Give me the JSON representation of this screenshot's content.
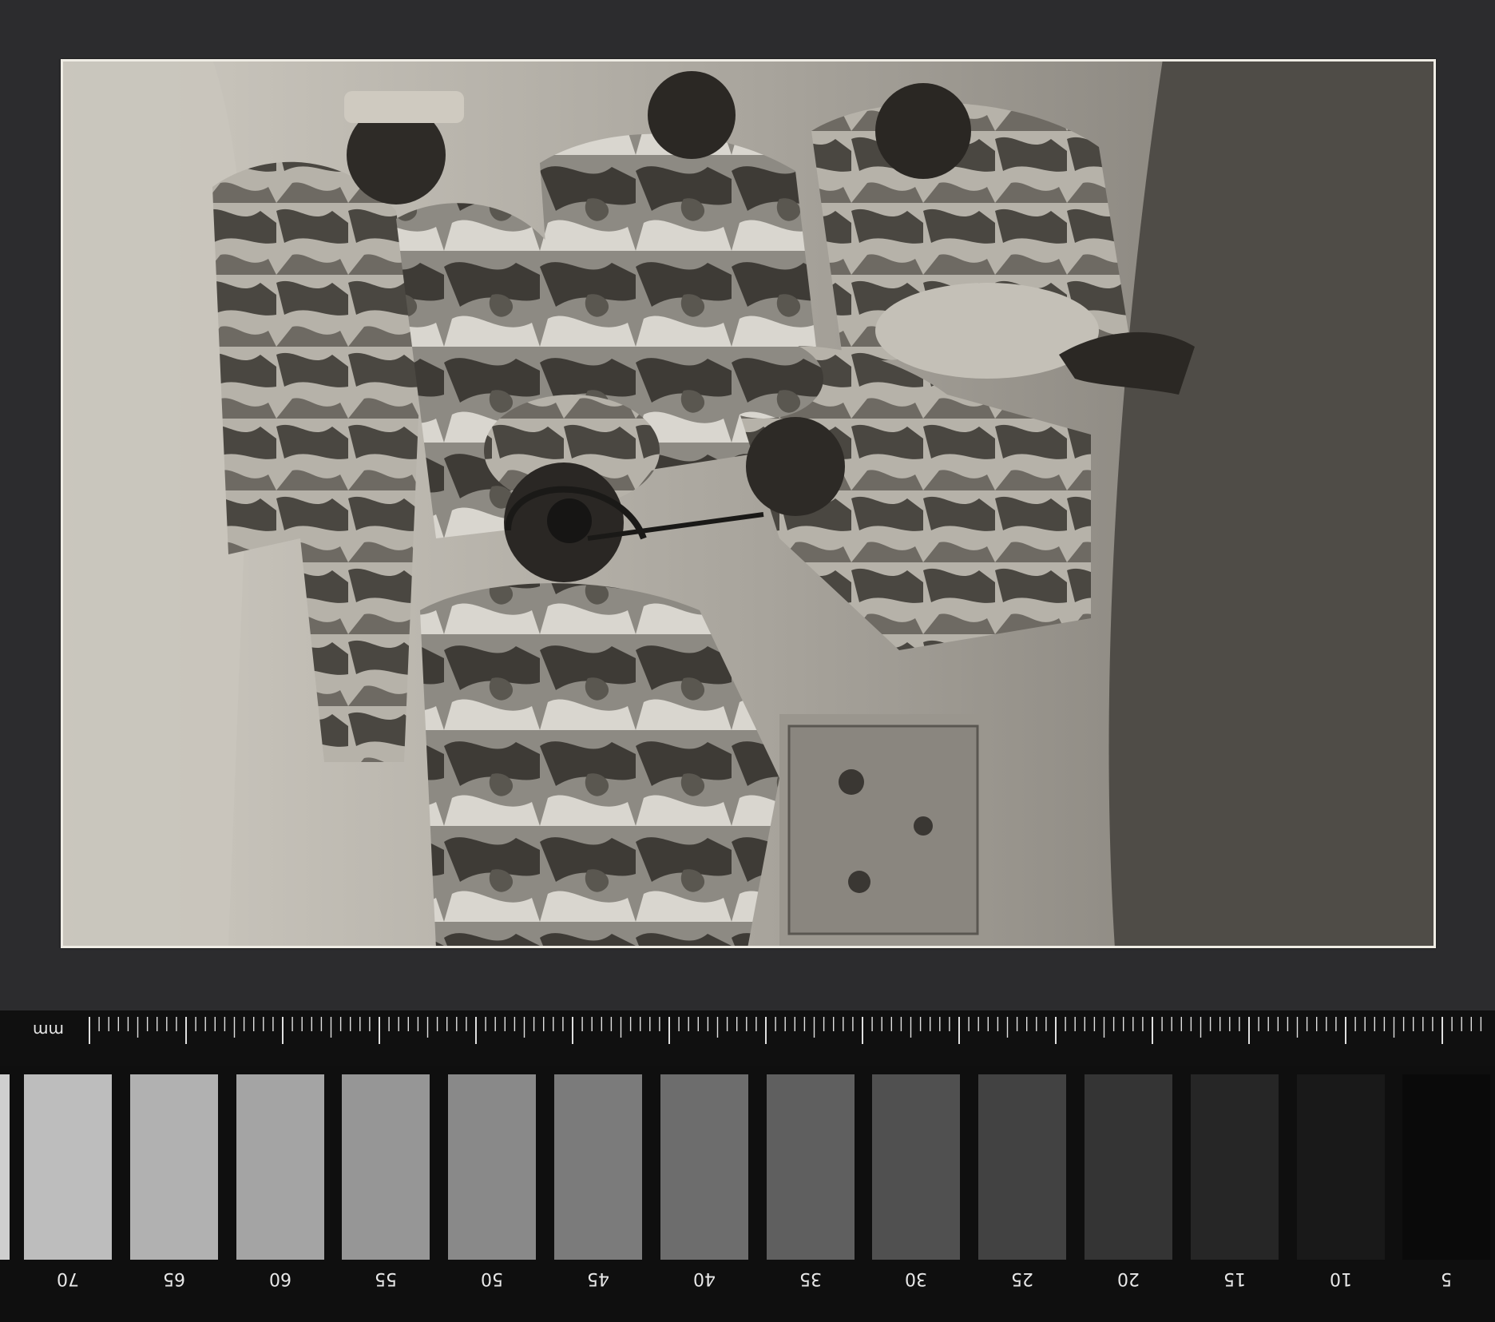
{
  "ruler": {
    "unit_label": "mm"
  },
  "gray_scale": {
    "patches": [
      {
        "color": "#bdbdbd",
        "label": "70"
      },
      {
        "color": "#b1b1b1",
        "label": "65"
      },
      {
        "color": "#a4a4a4",
        "label": "60"
      },
      {
        "color": "#969696",
        "label": "55"
      },
      {
        "color": "#898989",
        "label": "50"
      },
      {
        "color": "#7b7b7b",
        "label": "45"
      },
      {
        "color": "#6d6d6d",
        "label": "40"
      },
      {
        "color": "#5f5f5f",
        "label": "35"
      },
      {
        "color": "#505050",
        "label": "30"
      },
      {
        "color": "#424242",
        "label": "25"
      },
      {
        "color": "#343434",
        "label": "20"
      },
      {
        "color": "#262626",
        "label": "15"
      },
      {
        "color": "#191919",
        "label": "10"
      },
      {
        "color": "#0a0a0a",
        "label": "5"
      }
    ]
  }
}
